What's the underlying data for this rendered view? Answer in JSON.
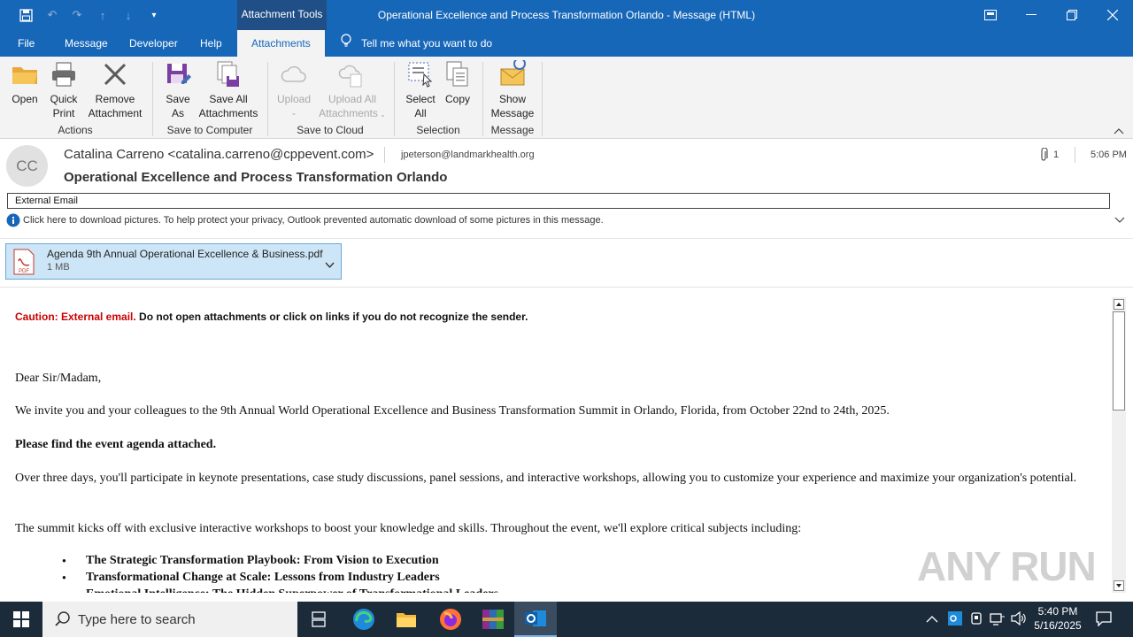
{
  "window": {
    "context_tab_group": "Attachment Tools",
    "title": "Operational Excellence and Process Transformation Orlando  -  Message (HTML)"
  },
  "tabs": [
    "File",
    "Message",
    "Developer",
    "Help",
    "Attachments"
  ],
  "active_tab": "Attachments",
  "tell_me": "Tell me what you want to do",
  "ribbon": {
    "actions": {
      "open": "Open",
      "quick_print_1": "Quick",
      "quick_print_2": "Print",
      "remove_1": "Remove",
      "remove_2": "Attachment",
      "group": "Actions"
    },
    "save_to_computer": {
      "save_as_1": "Save",
      "save_as_2": "As",
      "save_all_1": "Save All",
      "save_all_2": "Attachments",
      "group": "Save to Computer"
    },
    "save_to_cloud": {
      "upload": "Upload",
      "upload_all_1": "Upload All",
      "upload_all_2": "Attachments",
      "group": "Save to Cloud"
    },
    "selection": {
      "select_all_1": "Select",
      "select_all_2": "All",
      "copy": "Copy",
      "group": "Selection"
    },
    "message": {
      "show_1": "Show",
      "show_2": "Message",
      "group": "Message"
    }
  },
  "header": {
    "avatar_initials": "CC",
    "from": "Catalina Carreno <catalina.carreno@cppevent.com>",
    "to": "jpeterson@landmarkhealth.org",
    "attachment_count": "1",
    "time": "5:06 PM",
    "subject": "Operational Excellence and Process Transformation Orlando",
    "external_banner": "External Email",
    "info": "Click here to download pictures. To help protect your privacy, Outlook prevented automatic download of some pictures in this message."
  },
  "attachment": {
    "name": "Agenda 9th Annual Operational Excellence & Business.pdf",
    "size": "1 MB",
    "icon_label": "PDF"
  },
  "body": {
    "caution_label": "Caution: External email.",
    "caution_text": " Do not open attachments or click on links if you do not recognize the sender.",
    "greeting": "Dear Sir/Madam,",
    "p1": "We invite you and your colleagues to the 9th Annual World Operational Excellence and Business Transformation Summit in Orlando, Florida, from October 22nd to 24th, 2025.",
    "p2": "Please find the event agenda attached.",
    "p3": "Over three days, you'll participate in keynote presentations, case study discussions, panel sessions, and interactive workshops, allowing you to customize your experience and maximize your organization's potential.",
    "p4": "The summit kicks off with exclusive interactive workshops to boost your knowledge and skills. Throughout the event, we'll explore critical subjects including:",
    "bullets": [
      "The Strategic Transformation Playbook: From Vision to Execution",
      "Transformational Change at Scale: Lessons from Industry Leaders",
      "Emotional Intelligence: The Hidden Superpower of Transformational Leaders"
    ]
  },
  "watermark": "ANY RUN",
  "taskbar": {
    "search_placeholder": "Type here to search",
    "time": "5:40 PM",
    "date": "5/16/2025"
  },
  "colors": {
    "title_bar": "#1767b8",
    "caution_red": "#cc0000",
    "attachment_bg": "#cde6f7",
    "taskbar": "#1c2b3a"
  }
}
